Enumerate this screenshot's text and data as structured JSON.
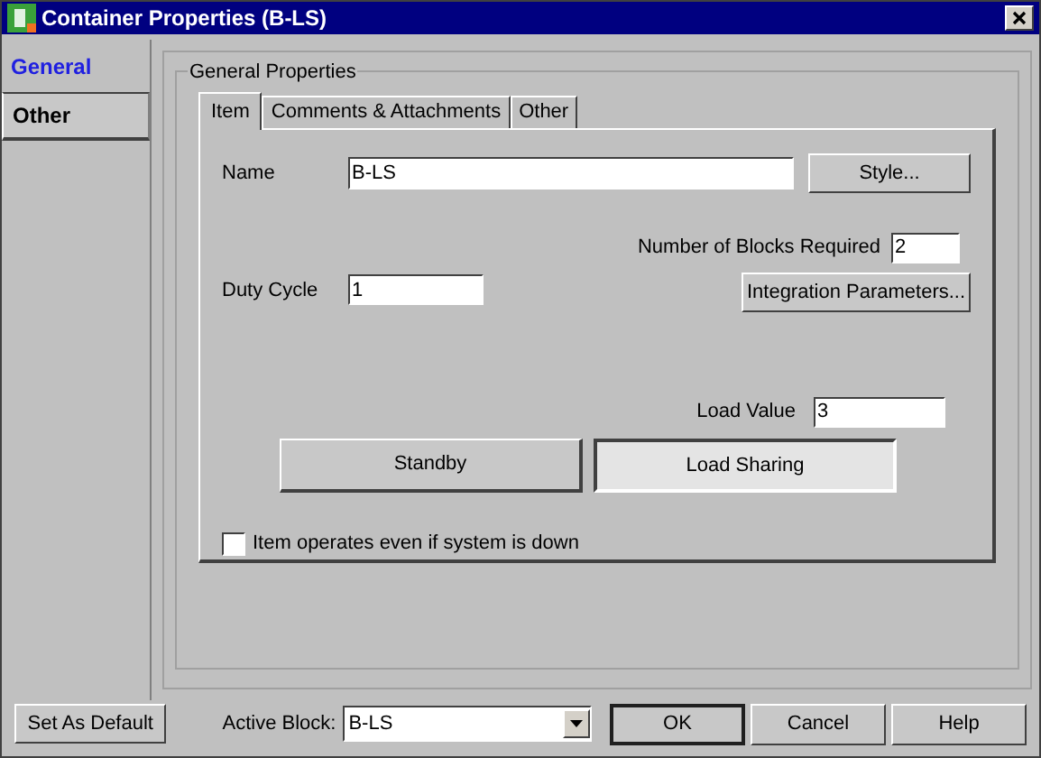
{
  "window": {
    "title": "Container Properties (B-LS)"
  },
  "nav": [
    {
      "label": "General",
      "selected": true
    },
    {
      "label": "Other",
      "selected": false
    }
  ],
  "group": {
    "title": "General Properties"
  },
  "tabs": [
    {
      "label": "Item",
      "selected": true
    },
    {
      "label": "Comments & Attachments",
      "selected": false
    },
    {
      "label": "Other",
      "selected": false
    }
  ],
  "name": {
    "label": "Name",
    "value": "B-LS"
  },
  "style_button": "Style...",
  "blocks_required": {
    "label": "Number of Blocks Required",
    "value": "2"
  },
  "duty_cycle": {
    "label": "Duty Cycle",
    "value": "1"
  },
  "integration_button": "Integration Parameters...",
  "load_value": {
    "label": "Load Value",
    "value": "3"
  },
  "modes": [
    {
      "label": "Standby",
      "selected": false
    },
    {
      "label": "Load Sharing",
      "selected": true
    }
  ],
  "operates_when_down": {
    "label": "Item operates even if system is down",
    "checked": false
  },
  "footer": {
    "default_button": "Set As Default",
    "active_block_label": "Active Block:",
    "active_block_value": "B-LS",
    "buttons": [
      "OK",
      "Cancel",
      "Help"
    ]
  }
}
